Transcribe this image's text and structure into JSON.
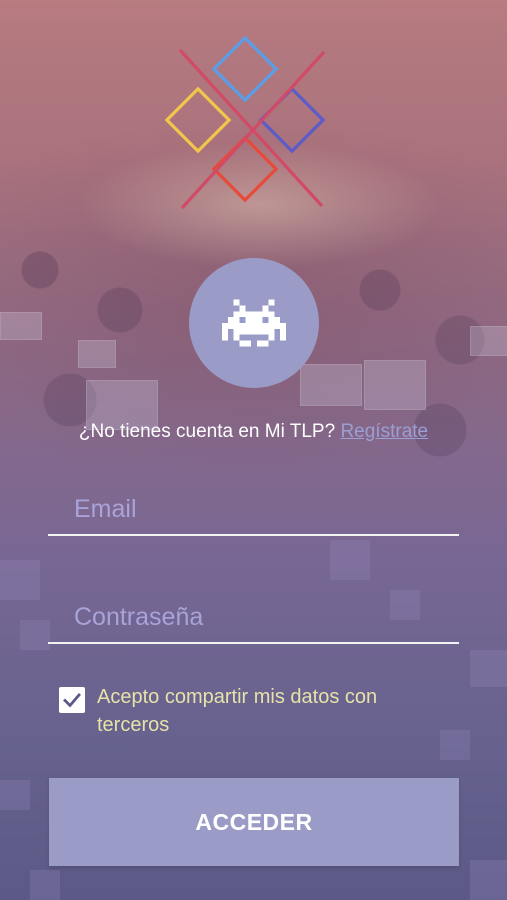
{
  "register": {
    "prompt": "¿No tienes cuenta en Mi TLP?",
    "link_label": "Regístrate"
  },
  "form": {
    "email_placeholder": "Email",
    "email_value": "",
    "password_placeholder": "Contraseña",
    "password_value": "",
    "consent_label": "Acepto compartir mis datos con terceros",
    "consent_checked": true,
    "submit_label": "ACCEDER"
  },
  "icons": {
    "logo": "tlp-diamond-logo-icon",
    "avatar": "space-invader-icon",
    "checkbox": "checkmark-icon"
  },
  "colors": {
    "accent": "#9a9cc7",
    "link": "#9b9fd4",
    "consent_text": "#e6e2a8",
    "logo_yellow": "#f1c64a",
    "logo_blue": "#5a9ee8",
    "logo_indigo": "#5c5cc8",
    "logo_red": "#e84a3a",
    "logo_magenta": "#d14a66"
  }
}
